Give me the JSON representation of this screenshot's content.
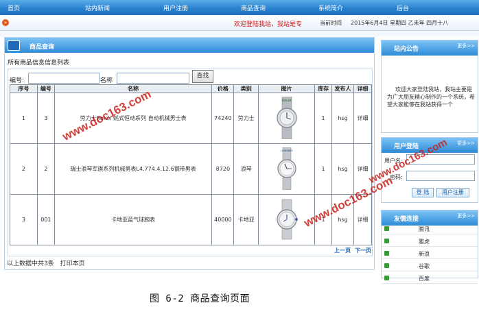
{
  "nav": [
    "首页",
    "站内新闻",
    "用户注册",
    "商品查询",
    "系统简介",
    "后台"
  ],
  "ticker": {
    "marquee": "欢迎登陆我站，我站是专",
    "time_label": "当前时间",
    "time_value": "2015年6月4日 星期四 乙未年 四月十八"
  },
  "main": {
    "title": "商品查询",
    "subtitle": "所有商品信息信息列表",
    "search": {
      "id_label": "编号:",
      "name_label": "名称",
      "button": "查找"
    },
    "columns": [
      "序号",
      "编号",
      "名称",
      "价格",
      "类别",
      "图片",
      "库存",
      "发布人",
      "详细"
    ],
    "rows": [
      {
        "seq": "1",
        "code": "3",
        "name": "劳力士Rolex 蚝式恒动系列 自动机械男士表",
        "price": "74240",
        "category": "劳力士",
        "stock": "1",
        "publisher": "hsg",
        "detail": "详细",
        "brand_mark": "ROLEX"
      },
      {
        "seq": "2",
        "code": "2",
        "name": "瑞士浪琴军旗系列机械男表L4.774.4.12.6钢带男表",
        "price": "8720",
        "category": "浪琴",
        "stock": "1",
        "publisher": "hsg",
        "detail": "详细",
        "brand_mark": "LONGINES"
      },
      {
        "seq": "3",
        "code": "001",
        "name": "卡地亚蓝气球腕表",
        "price": "40000",
        "category": "卡地亚",
        "stock": "1",
        "publisher": "hsg",
        "detail": "详细",
        "brand_mark": ""
      }
    ],
    "pager": {
      "prev": "上一页",
      "next": "下一页"
    },
    "footer": {
      "count": "以上数据中共3条",
      "print": "打印本页"
    }
  },
  "notice": {
    "title": "站内公告",
    "more": "更多>>",
    "text": "欢迎大家登陆我站，我站主要是为广大朋友精心制作的一个系统，希望大家能够在我站获得一个"
  },
  "login": {
    "title": "用户登陆",
    "more": "更多>>",
    "user_label": "用户名:",
    "pwd_label": "密码:",
    "login_button": "登 陆",
    "register_button": "用户注册"
  },
  "links": {
    "title": "友情连接",
    "more": "更多>>",
    "items": [
      "腾讯",
      "雅虎",
      "新浪",
      "谷歌",
      "百度"
    ]
  },
  "watermarks": [
    "www.doc163.com",
    "www.doc163.com",
    "www.doc163.com"
  ],
  "caption": "图 6-2 商品查询页面",
  "colors": {
    "nav_blue": "#2b82cf",
    "marquee_red": "#d01010",
    "watermark_red": "#c8201b"
  }
}
